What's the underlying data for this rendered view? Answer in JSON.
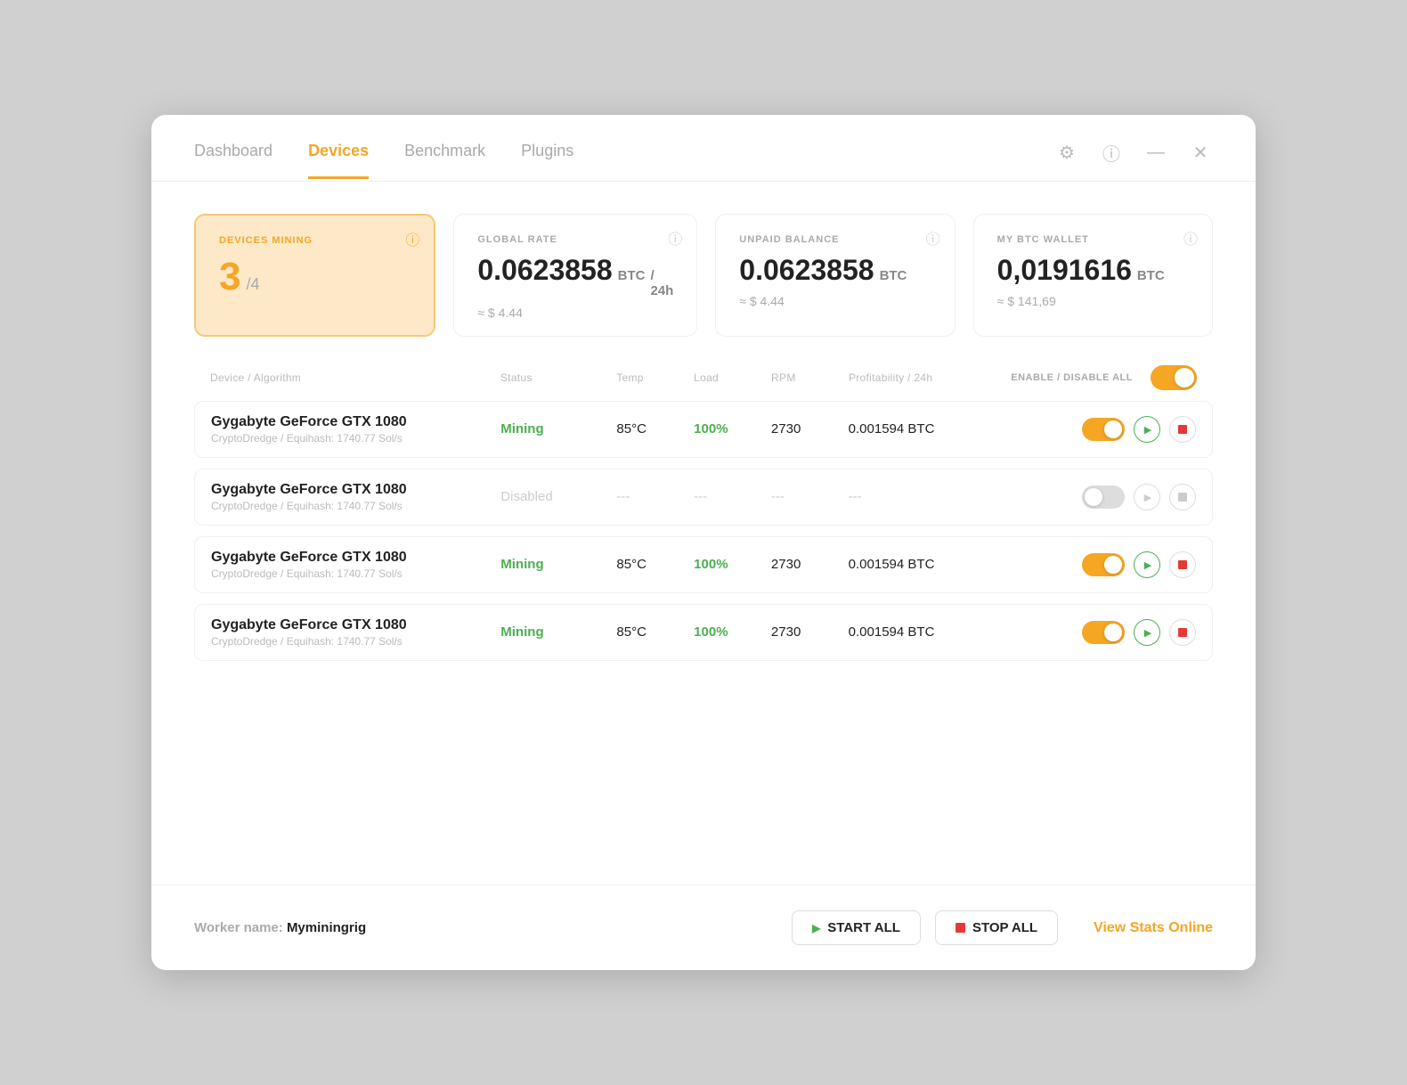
{
  "nav": {
    "tabs": [
      {
        "label": "Dashboard",
        "active": false
      },
      {
        "label": "Devices",
        "active": true
      },
      {
        "label": "Benchmark",
        "active": false
      },
      {
        "label": "Plugins",
        "active": false
      }
    ]
  },
  "cards": {
    "devices_mining": {
      "label": "DEVICES MINING",
      "value": "3",
      "sub": "/4"
    },
    "global_rate": {
      "label": "GLOBAL RATE",
      "value": "0.0623858",
      "unit": "BTC",
      "period": "/ 24h",
      "sub": "≈ $ 4.44"
    },
    "unpaid_balance": {
      "label": "UNPAID BALANCE",
      "value": "0.0623858",
      "unit": "BTC",
      "sub": "≈ $ 4.44"
    },
    "my_btc_wallet": {
      "label": "MY BTC WALLET",
      "value": "0,0191616",
      "unit": "BTC",
      "sub": "≈ $ 141,69"
    }
  },
  "table": {
    "headers": {
      "device": "Device / Algorithm",
      "status": "Status",
      "temp": "Temp",
      "load": "Load",
      "rpm": "RPM",
      "profit": "Profitability / 24h",
      "enable_disable": "ENABLE / DISABLE ALL"
    },
    "rows": [
      {
        "name": "Gygabyte GeForce GTX 1080",
        "algo": "CryptoDredge / Equihash: 1740.77 Sol/s",
        "status": "Mining",
        "status_type": "mining",
        "temp": "85°C",
        "load": "100%",
        "rpm": "2730",
        "profit": "0.001594 BTC",
        "enabled": true
      },
      {
        "name": "Gygabyte GeForce GTX 1080",
        "algo": "CryptoDredge / Equihash: 1740.77 Sol/s",
        "status": "Disabled",
        "status_type": "disabled",
        "temp": "---",
        "load": "---",
        "rpm": "---",
        "profit": "---",
        "enabled": false
      },
      {
        "name": "Gygabyte GeForce GTX 1080",
        "algo": "CryptoDredge / Equihash: 1740.77 Sol/s",
        "status": "Mining",
        "status_type": "mining",
        "temp": "85°C",
        "load": "100%",
        "rpm": "2730",
        "profit": "0.001594 BTC",
        "enabled": true
      },
      {
        "name": "Gygabyte GeForce GTX 1080",
        "algo": "CryptoDredge / Equihash: 1740.77 Sol/s",
        "status": "Mining",
        "status_type": "mining",
        "temp": "85°C",
        "load": "100%",
        "rpm": "2730",
        "profit": "0.001594 BTC",
        "enabled": true
      }
    ]
  },
  "footer": {
    "worker_label": "Worker name:",
    "worker_name": "Myminingrig",
    "start_all": "START ALL",
    "stop_all": "STOP ALL",
    "view_stats": "View Stats Online"
  }
}
